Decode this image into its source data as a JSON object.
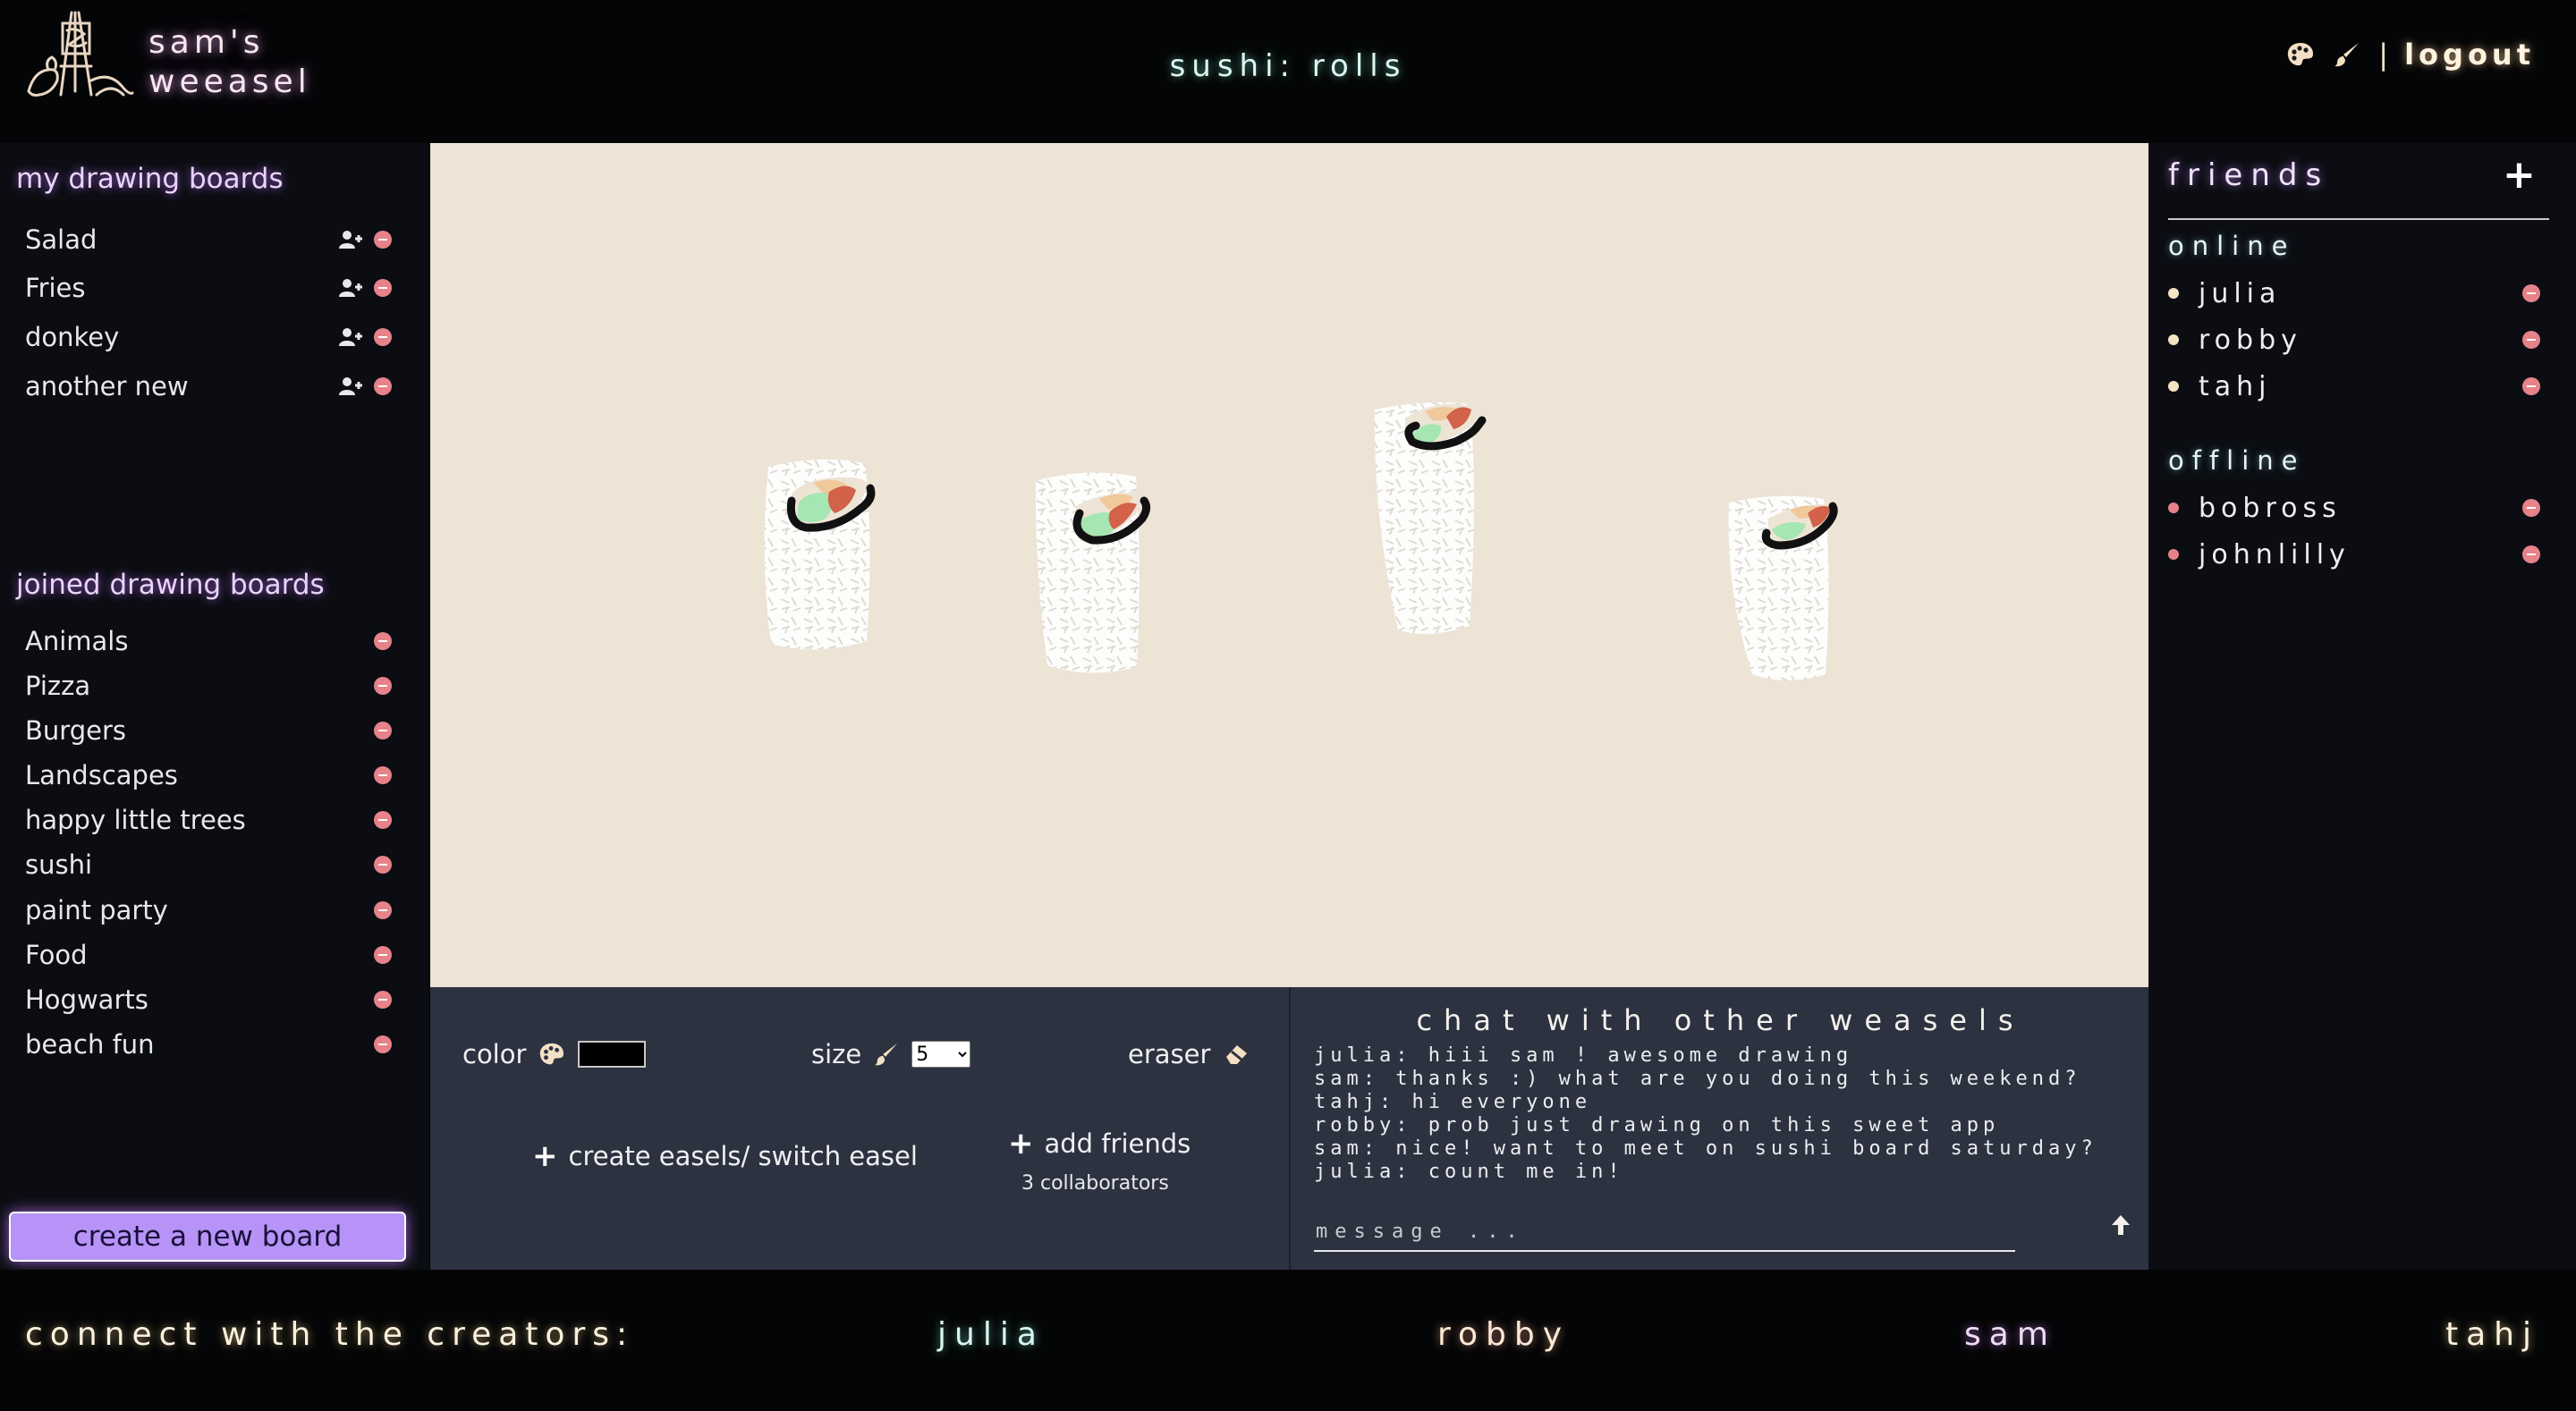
{
  "header": {
    "brand": [
      "sam's",
      "weeasel"
    ],
    "board_title": "sushi: rolls",
    "separator": "|",
    "logout_label": "logout",
    "icons": [
      "palette-icon",
      "brush-icon"
    ]
  },
  "sidebar": {
    "my_boards_title": "my drawing boards",
    "my_boards": [
      {
        "label": "Salad"
      },
      {
        "label": "Fries"
      },
      {
        "label": "donkey"
      },
      {
        "label": "another new"
      }
    ],
    "joined_boards_title": "joined drawing boards",
    "joined_boards": [
      {
        "label": "Animals"
      },
      {
        "label": "Pizza"
      },
      {
        "label": "Burgers"
      },
      {
        "label": "Landscapes"
      },
      {
        "label": "happy little trees"
      },
      {
        "label": "sushi"
      },
      {
        "label": "paint party"
      },
      {
        "label": "Food"
      },
      {
        "label": "Hogwarts"
      },
      {
        "label": "beach fun"
      }
    ],
    "create_button": "create a new board"
  },
  "tools": {
    "color_label": "color",
    "color_value": "#000000",
    "size_label": "size",
    "size_value": "5",
    "eraser_label": "eraser",
    "create_switch_label": "create easels/ switch easel",
    "add_friends_label": "add friends",
    "collaborators": "3 collaborators"
  },
  "chat": {
    "title": "chat with other weasels",
    "messages": [
      "julia: hiii sam ! awesome drawing",
      "sam: thanks :) what are you doing this weekend?",
      "tahj: hi everyone",
      "robby: prob just drawing on this sweet app",
      "sam: nice! want to meet on sushi board saturday?",
      "julia: count me in!"
    ],
    "input_placeholder": "message ..."
  },
  "friends": {
    "title": "friends",
    "online_title": "online",
    "online": [
      {
        "name": "julia"
      },
      {
        "name": "robby"
      },
      {
        "name": "tahj"
      }
    ],
    "offline_title": "offline",
    "offline": [
      {
        "name": "bobross"
      },
      {
        "name": "johnlilly"
      }
    ],
    "online_dot_color": "#f3e4c2",
    "offline_dot_color": "#e6828a"
  },
  "footer": {
    "label": "connect with the creators:",
    "creators": [
      {
        "name": "julia",
        "color": "#d8f6ee"
      },
      {
        "name": "robby",
        "color": "#fde9d6"
      },
      {
        "name": "sam",
        "color": "#f1dcf4"
      },
      {
        "name": "tahj",
        "color": "#fbf1de"
      }
    ]
  },
  "colors": {
    "page_background": "#050608",
    "panel_background": "#0b0d12",
    "canvas_background": "#ede4d5",
    "tools_background": "#2c3240",
    "accent_purple": "#b793f7",
    "remove_red": "#e6828a"
  }
}
